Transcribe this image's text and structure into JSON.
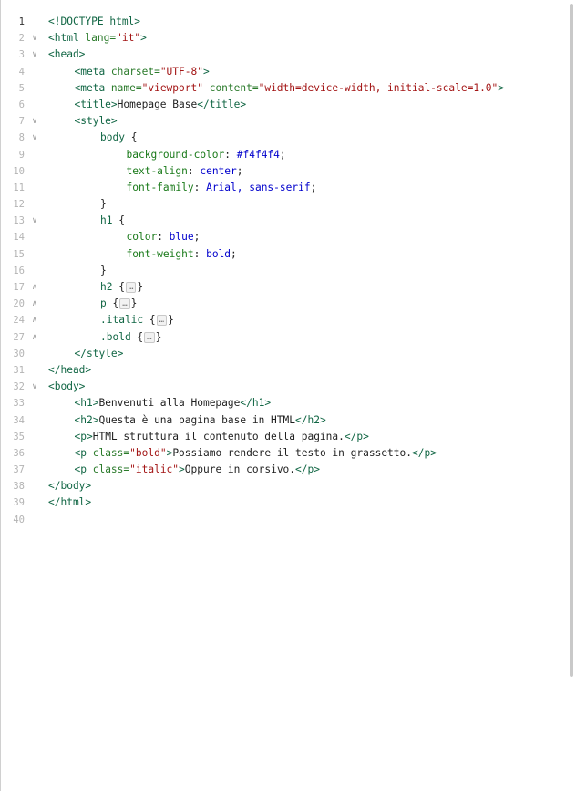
{
  "editor": {
    "lines": [
      {
        "n": "1",
        "fold": "",
        "active": true,
        "indent": 0,
        "tokens": [
          {
            "c": "t-doc",
            "t": "<!DOCTYPE html>"
          }
        ]
      },
      {
        "n": "2",
        "fold": "v",
        "indent": 0,
        "tokens": [
          {
            "c": "t-tag",
            "t": "<html "
          },
          {
            "c": "t-attr",
            "t": "lang="
          },
          {
            "c": "t-str",
            "t": "\"it\""
          },
          {
            "c": "t-tag",
            "t": ">"
          }
        ]
      },
      {
        "n": "3",
        "fold": "v",
        "indent": 0,
        "tokens": [
          {
            "c": "t-tag",
            "t": "<head>"
          }
        ]
      },
      {
        "n": "4",
        "fold": "",
        "indent": 1,
        "tokens": [
          {
            "c": "t-tag",
            "t": "<meta "
          },
          {
            "c": "t-attr",
            "t": "charset="
          },
          {
            "c": "t-str",
            "t": "\"UTF-8\""
          },
          {
            "c": "t-tag",
            "t": ">"
          }
        ]
      },
      {
        "n": "5",
        "fold": "",
        "indent": 1,
        "tokens": [
          {
            "c": "t-tag",
            "t": "<meta "
          },
          {
            "c": "t-attr",
            "t": "name="
          },
          {
            "c": "t-str",
            "t": "\"viewport\""
          },
          {
            "c": "t-attr",
            "t": " content="
          },
          {
            "c": "t-str",
            "t": "\"width=device-width, initial-scale=1.0\""
          },
          {
            "c": "t-tag",
            "t": ">"
          }
        ]
      },
      {
        "n": "6",
        "fold": "",
        "indent": 1,
        "tokens": [
          {
            "c": "t-tag",
            "t": "<title>"
          },
          {
            "c": "t-txt",
            "t": "Homepage Base"
          },
          {
            "c": "t-tag",
            "t": "</title>"
          }
        ]
      },
      {
        "n": "7",
        "fold": "v",
        "indent": 1,
        "tokens": [
          {
            "c": "t-tag",
            "t": "<style>"
          }
        ]
      },
      {
        "n": "8",
        "fold": "v",
        "indent": 2,
        "tokens": [
          {
            "c": "t-sel",
            "t": "body "
          },
          {
            "c": "t-txt",
            "t": "{"
          }
        ]
      },
      {
        "n": "9",
        "fold": "",
        "indent": 3,
        "tokens": [
          {
            "c": "t-prop",
            "t": "background-color"
          },
          {
            "c": "t-txt",
            "t": ": "
          },
          {
            "c": "t-val",
            "t": "#f4f4f4"
          },
          {
            "c": "t-txt",
            "t": ";"
          }
        ]
      },
      {
        "n": "10",
        "fold": "",
        "indent": 3,
        "tokens": [
          {
            "c": "t-prop",
            "t": "text-align"
          },
          {
            "c": "t-txt",
            "t": ": "
          },
          {
            "c": "t-val",
            "t": "center"
          },
          {
            "c": "t-txt",
            "t": ";"
          }
        ]
      },
      {
        "n": "11",
        "fold": "",
        "indent": 3,
        "tokens": [
          {
            "c": "t-prop",
            "t": "font-family"
          },
          {
            "c": "t-txt",
            "t": ": "
          },
          {
            "c": "t-val",
            "t": "Arial, sans-serif"
          },
          {
            "c": "t-txt",
            "t": ";"
          }
        ]
      },
      {
        "n": "12",
        "fold": "",
        "indent": 2,
        "tokens": [
          {
            "c": "t-txt",
            "t": "}"
          }
        ]
      },
      {
        "n": "13",
        "fold": "v",
        "indent": 2,
        "tokens": [
          {
            "c": "t-sel",
            "t": "h1 "
          },
          {
            "c": "t-txt",
            "t": "{"
          }
        ]
      },
      {
        "n": "14",
        "fold": "",
        "indent": 3,
        "tokens": [
          {
            "c": "t-prop",
            "t": "color"
          },
          {
            "c": "t-txt",
            "t": ": "
          },
          {
            "c": "t-val",
            "t": "blue"
          },
          {
            "c": "t-txt",
            "t": ";"
          }
        ]
      },
      {
        "n": "15",
        "fold": "",
        "indent": 3,
        "tokens": [
          {
            "c": "t-prop",
            "t": "font-weight"
          },
          {
            "c": "t-txt",
            "t": ": "
          },
          {
            "c": "t-val",
            "t": "bold"
          },
          {
            "c": "t-txt",
            "t": ";"
          }
        ]
      },
      {
        "n": "16",
        "fold": "",
        "indent": 2,
        "tokens": [
          {
            "c": "t-txt",
            "t": "}"
          }
        ]
      },
      {
        "n": "17",
        "fold": "^",
        "indent": 2,
        "collapsed": true,
        "tokens": [
          {
            "c": "t-sel",
            "t": "h2 "
          },
          {
            "c": "t-txt",
            "t": "{"
          },
          {
            "c": "box",
            "t": "…"
          },
          {
            "c": "t-txt",
            "t": "}"
          }
        ]
      },
      {
        "n": "20",
        "fold": "^",
        "indent": 2,
        "collapsed": true,
        "tokens": [
          {
            "c": "t-sel",
            "t": "p "
          },
          {
            "c": "t-txt",
            "t": "{"
          },
          {
            "c": "box",
            "t": "…"
          },
          {
            "c": "t-txt",
            "t": "}"
          }
        ]
      },
      {
        "n": "24",
        "fold": "^",
        "indent": 2,
        "collapsed": true,
        "tokens": [
          {
            "c": "t-sel",
            "t": ".italic "
          },
          {
            "c": "t-txt",
            "t": "{"
          },
          {
            "c": "box",
            "t": "…"
          },
          {
            "c": "t-txt",
            "t": "}"
          }
        ]
      },
      {
        "n": "27",
        "fold": "^",
        "indent": 2,
        "collapsed": true,
        "tokens": [
          {
            "c": "t-sel",
            "t": ".bold "
          },
          {
            "c": "t-txt",
            "t": "{"
          },
          {
            "c": "box",
            "t": "…"
          },
          {
            "c": "t-txt",
            "t": "}"
          }
        ]
      },
      {
        "n": "30",
        "fold": "",
        "indent": 1,
        "tokens": [
          {
            "c": "t-tag",
            "t": "</style>"
          }
        ]
      },
      {
        "n": "31",
        "fold": "",
        "indent": 0,
        "tokens": [
          {
            "c": "t-tag",
            "t": "</head>"
          }
        ]
      },
      {
        "n": "32",
        "fold": "v",
        "indent": 0,
        "tokens": [
          {
            "c": "t-tag",
            "t": "<body>"
          }
        ]
      },
      {
        "n": "33",
        "fold": "",
        "indent": 1,
        "tokens": [
          {
            "c": "t-tag",
            "t": "<h1>"
          },
          {
            "c": "t-txt",
            "t": "Benvenuti alla Homepage"
          },
          {
            "c": "t-tag",
            "t": "</h1>"
          }
        ]
      },
      {
        "n": "34",
        "fold": "",
        "indent": 1,
        "tokens": [
          {
            "c": "t-tag",
            "t": "<h2>"
          },
          {
            "c": "t-txt",
            "t": "Questa è una pagina base in HTML"
          },
          {
            "c": "t-tag",
            "t": "</h2>"
          }
        ]
      },
      {
        "n": "35",
        "fold": "",
        "indent": 1,
        "tokens": [
          {
            "c": "t-tag",
            "t": "<p>"
          },
          {
            "c": "t-txt",
            "t": "HTML struttura il contenuto della pagina."
          },
          {
            "c": "t-tag",
            "t": "</p>"
          }
        ]
      },
      {
        "n": "36",
        "fold": "",
        "indent": 1,
        "tokens": [
          {
            "c": "t-tag",
            "t": "<p "
          },
          {
            "c": "t-attr",
            "t": "class="
          },
          {
            "c": "t-str",
            "t": "\"bold\""
          },
          {
            "c": "t-tag",
            "t": ">"
          },
          {
            "c": "t-txt",
            "t": "Possiamo rendere il testo in grassetto."
          },
          {
            "c": "t-tag",
            "t": "</p>"
          }
        ]
      },
      {
        "n": "37",
        "fold": "",
        "indent": 1,
        "tokens": [
          {
            "c": "t-tag",
            "t": "<p "
          },
          {
            "c": "t-attr",
            "t": "class="
          },
          {
            "c": "t-str",
            "t": "\"italic\""
          },
          {
            "c": "t-tag",
            "t": ">"
          },
          {
            "c": "t-txt",
            "t": "Oppure in corsivo."
          },
          {
            "c": "t-tag",
            "t": "</p>"
          }
        ]
      },
      {
        "n": "38",
        "fold": "",
        "indent": 0,
        "tokens": [
          {
            "c": "t-tag",
            "t": "</body>"
          }
        ]
      },
      {
        "n": "39",
        "fold": "",
        "indent": 0,
        "tokens": [
          {
            "c": "t-tag",
            "t": "</html>"
          }
        ]
      },
      {
        "n": "40",
        "fold": "",
        "indent": 0,
        "tokens": []
      }
    ]
  }
}
